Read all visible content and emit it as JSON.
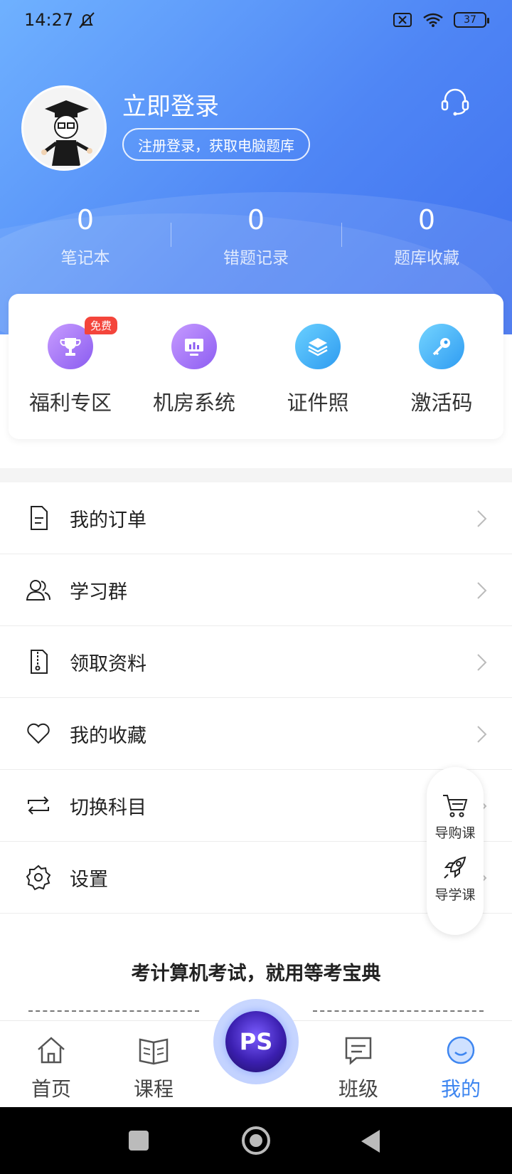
{
  "status_bar": {
    "time": "14:27",
    "battery": "37"
  },
  "profile": {
    "login_title": "立即登录",
    "login_subtitle": "注册登录，获取电脑题库",
    "stats": [
      {
        "value": "0",
        "label": "笔记本"
      },
      {
        "value": "0",
        "label": "错题记录"
      },
      {
        "value": "0",
        "label": "题库收藏"
      }
    ]
  },
  "quick_actions": [
    {
      "label": "福利专区",
      "badge": "免费",
      "icon": "trophy-icon"
    },
    {
      "label": "机房系统",
      "icon": "monitor-icon"
    },
    {
      "label": "证件照",
      "icon": "layers-icon"
    },
    {
      "label": "激活码",
      "icon": "key-icon"
    }
  ],
  "menu": [
    {
      "label": "我的订单",
      "icon": "order-icon"
    },
    {
      "label": "学习群",
      "icon": "group-icon"
    },
    {
      "label": "领取资料",
      "icon": "document-icon"
    },
    {
      "label": "我的收藏",
      "icon": "heart-icon"
    },
    {
      "label": "切换科目",
      "icon": "switch-icon"
    },
    {
      "label": "设置",
      "icon": "gear-icon"
    }
  ],
  "floater": {
    "buy_label": "导购课",
    "learn_label": "导学课"
  },
  "slogan": "考计算机考试，就用等考宝典",
  "tabs": [
    {
      "label": "首页"
    },
    {
      "label": "课程"
    },
    {
      "label": "PS"
    },
    {
      "label": "班级"
    },
    {
      "label": "我的"
    }
  ],
  "colors": {
    "header_start": "#6fb1ff",
    "header_end": "#3f70ee",
    "active_tab": "#3e86f0",
    "badge": "#f4453b"
  }
}
